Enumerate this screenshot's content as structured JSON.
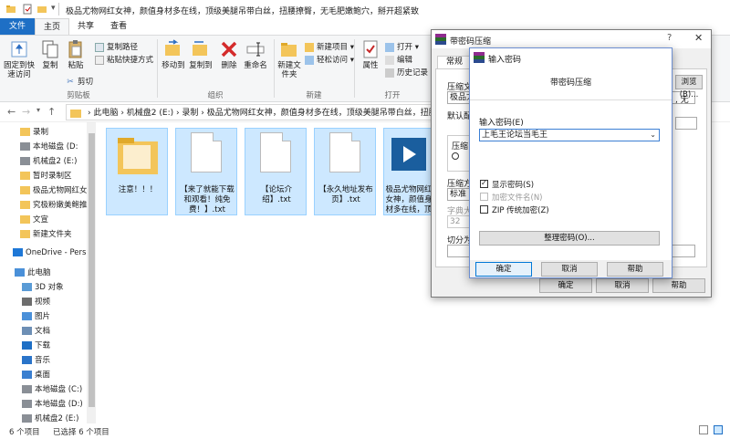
{
  "explorer": {
    "title": "极品尤物网红女神，颜值身材多在线，顶级美腿吊带白丝，扭腰撩臀，无毛肥嫩鲍穴，掰开超紧致",
    "tabs": {
      "file": "文件",
      "home": "主页",
      "share": "共享",
      "view": "查看"
    },
    "ribbon": {
      "pin_quick_access": "固定到快速访问",
      "copy": "复制",
      "paste": "粘贴",
      "copy_path": "复制路径",
      "paste_shortcut": "粘贴快捷方式",
      "cut": "剪切",
      "group_clipboard": "剪贴板",
      "move_to": "移动到",
      "copy_to": "复制到",
      "delete": "删除",
      "rename": "重命名",
      "group_organize": "组织",
      "new_folder": "新建文件夹",
      "new_item": "新建项目 ▾",
      "easy_access": "轻松访问 ▾",
      "group_new": "新建",
      "properties": "属性",
      "open": "打开 ▾",
      "edit": "编辑",
      "history": "历史记录",
      "group_open": "打开"
    },
    "address": {
      "path": "›  此电脑  ›  机械盘2 (E:)  ›  录制  ›  极品尤物网红女神，颜值身材多在线，顶级美腿吊带白丝，扭腰撩臀"
    },
    "nav": [
      {
        "label": "录制",
        "icon": "folder"
      },
      {
        "label": "本地磁盘 (D:",
        "icon": "drive"
      },
      {
        "label": "机械盘2 (E:)",
        "icon": "drive"
      },
      {
        "label": "暂时录制区",
        "icon": "folder"
      },
      {
        "label": "极品尤物网红女",
        "icon": "folder"
      },
      {
        "label": "究极粉嫩美鲍推",
        "icon": "folder"
      },
      {
        "label": "文宣",
        "icon": "folder"
      },
      {
        "label": "新建文件夹",
        "icon": "folder"
      },
      {
        "label": "OneDrive - Pers",
        "icon": "cloud"
      },
      {
        "label": "此电脑",
        "icon": "pc"
      },
      {
        "label": "3D 对象",
        "icon": "cube"
      },
      {
        "label": "视频",
        "icon": "video"
      },
      {
        "label": "图片",
        "icon": "picture"
      },
      {
        "label": "文档",
        "icon": "document"
      },
      {
        "label": "下载",
        "icon": "download"
      },
      {
        "label": "音乐",
        "icon": "music"
      },
      {
        "label": "桌面",
        "icon": "desktop"
      },
      {
        "label": "本地磁盘 (C:)",
        "icon": "drive"
      },
      {
        "label": "本地磁盘 (D:)",
        "icon": "drive"
      },
      {
        "label": "机械盘2 (E:)",
        "icon": "drive"
      }
    ],
    "files": [
      {
        "name": "注意！！！",
        "type": "folder"
      },
      {
        "name": "【来了就能下载和观看！纯免费！】.txt",
        "type": "txt"
      },
      {
        "name": "【论坛介绍】.txt",
        "type": "txt"
      },
      {
        "name": "【永久地址发布页】.txt",
        "type": "txt"
      },
      {
        "name": "极品尤物网红女神，颜值身材多在线，顶级美腿吊带白丝，扭",
        "type": "video"
      }
    ],
    "status": {
      "count": "6 个项目",
      "selected": "已选择 6 个项目"
    }
  },
  "archive_dialog": {
    "title": "带密码压缩",
    "tab_general": "常规",
    "label_archive": "压缩文",
    "archive_value": "极品尤",
    "browse": "浏览(B)...",
    "format_value": ", 无",
    "label_profile": "默认配",
    "label_format": "压缩",
    "label_method": "压缩方",
    "method_value": "标准",
    "label_dict": "字典大",
    "dict_value": "32",
    "label_split": "切分为",
    "ok": "确定",
    "cancel": "取消",
    "help": "帮助"
  },
  "password_dialog": {
    "title": "输入密码",
    "header": "带密码压缩",
    "label": "输入密码(E)",
    "password_value": "上毛王论坛当毛王",
    "show_password": "显示密码(S)",
    "encrypt_names": "加密文件名(N)",
    "zip_legacy": "ZIP 传统加密(Z)",
    "organize": "整理密码(O)...",
    "ok": "确定",
    "cancel": "取消",
    "help": "帮助"
  },
  "colors": {
    "accent": "#1e6fc5",
    "selection": "#cde8ff",
    "folder": "#f3c55a"
  }
}
